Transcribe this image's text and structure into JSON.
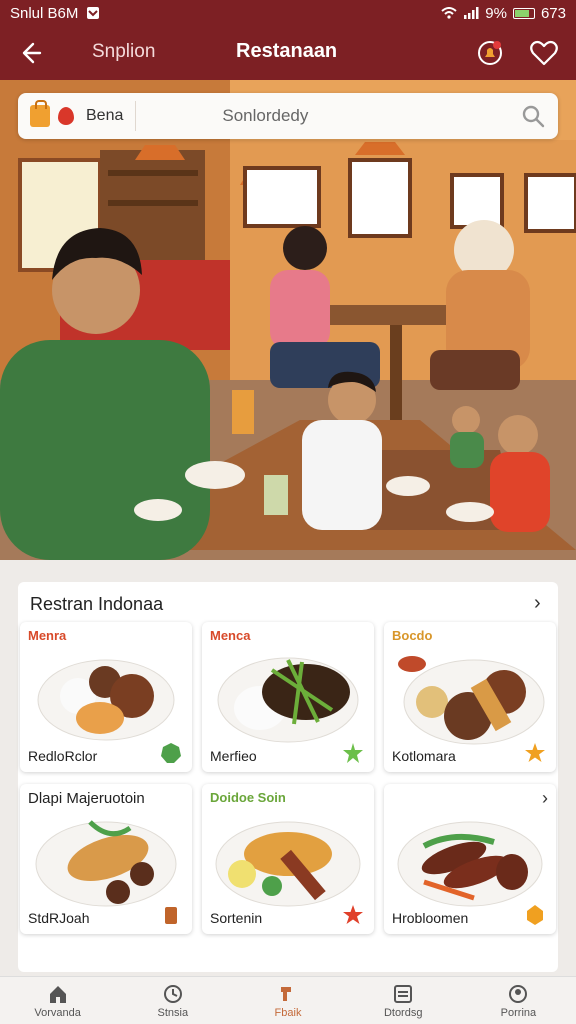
{
  "status_bar": {
    "carrier": "Snlul B6M",
    "signal_pct": "9%",
    "time": "673"
  },
  "app_bar": {
    "subtitle": "Snplion",
    "title": "Restanaan"
  },
  "search": {
    "chip_label": "Bena",
    "placeholder": "Sonlordedy"
  },
  "section": {
    "title": "Restran Indonaa",
    "cards": [
      {
        "tag": "Menra",
        "name": "RedloRclor",
        "tag_color": "#d84a2a"
      },
      {
        "tag": "Menca",
        "name": "Merfieo",
        "tag_color": "#d84a2a"
      },
      {
        "tag": "Bocdo",
        "name": "Kotlomara",
        "tag_color": "#d8962a"
      }
    ],
    "row2_title": "Dlapi Majeruotoin",
    "row2_tag": "Doidoe Soin",
    "cards2": [
      {
        "name": "StdRJoah"
      },
      {
        "name": "Sortenin"
      },
      {
        "name": "Hrobloomen"
      }
    ]
  },
  "bottom_nav": [
    {
      "label": "Vorvanda",
      "icon": "home-icon"
    },
    {
      "label": "Stnsia",
      "icon": "clock-icon"
    },
    {
      "label": "Fbaik",
      "icon": "lamp-icon"
    },
    {
      "label": "Dtordsg",
      "icon": "list-icon"
    },
    {
      "label": "Porrina",
      "icon": "profile-icon"
    }
  ],
  "colors": {
    "brand": "#7d2024",
    "accent": "#c46a3a"
  }
}
